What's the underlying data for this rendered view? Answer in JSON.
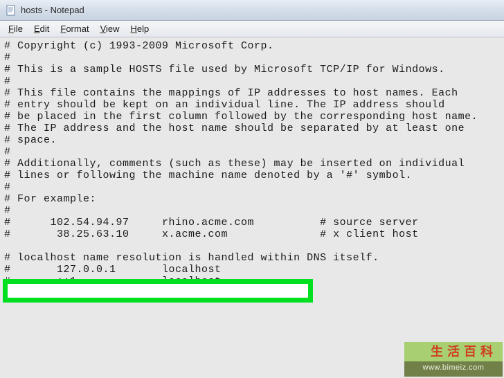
{
  "window": {
    "title": "hosts - Notepad"
  },
  "menu": {
    "file": "File",
    "edit": "Edit",
    "format": "Format",
    "view": "View",
    "help": "Help"
  },
  "editor": {
    "content": "# Copyright (c) 1993-2009 Microsoft Corp.\n#\n# This is a sample HOSTS file used by Microsoft TCP/IP for Windows.\n#\n# This file contains the mappings of IP addresses to host names. Each\n# entry should be kept on an individual line. The IP address should\n# be placed in the first column followed by the corresponding host name.\n# The IP address and the host name should be separated by at least one\n# space.\n#\n# Additionally, comments (such as these) may be inserted on individual\n# lines or following the machine name denoted by a '#' symbol.\n#\n# For example:\n#\n#      102.54.94.97     rhino.acme.com          # source server\n#       38.25.63.10     x.acme.com              # x client host\n\n# localhost name resolution is handled within DNS itself.\n#       127.0.0.1       localhost\n#       ::1             localhost"
  },
  "watermark": {
    "title": "生活百科",
    "url": "www.bimeiz.com"
  }
}
